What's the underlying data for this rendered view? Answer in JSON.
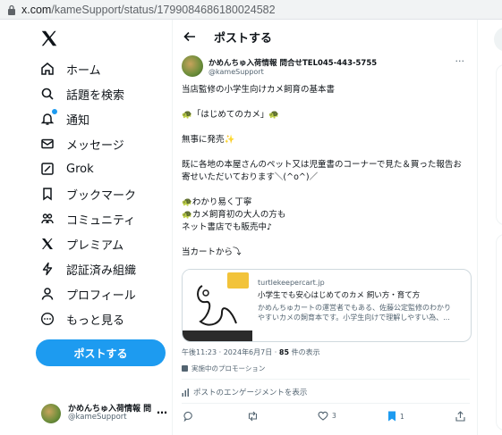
{
  "browser": {
    "url_host": "x.com",
    "url_path": "/kameSupport/status/1799084686180024582"
  },
  "nav": {
    "items": [
      {
        "label": "ホーム",
        "icon": "home-icon"
      },
      {
        "label": "話題を検索",
        "icon": "search-icon"
      },
      {
        "label": "通知",
        "icon": "bell-icon"
      },
      {
        "label": "メッセージ",
        "icon": "mail-icon"
      },
      {
        "label": "Grok",
        "icon": "grok-icon"
      },
      {
        "label": "ブックマーク",
        "icon": "bookmark-icon"
      },
      {
        "label": "コミュニティ",
        "icon": "communities-icon"
      },
      {
        "label": "プレミアム",
        "icon": "x-premium-icon"
      },
      {
        "label": "認証済み組織",
        "icon": "lightning-icon"
      },
      {
        "label": "プロフィール",
        "icon": "person-icon"
      },
      {
        "label": "もっと見る",
        "icon": "more-circle-icon"
      }
    ],
    "post_button": "ポストする"
  },
  "account": {
    "name": "かめんちゅ入荷情報 問",
    "handle": "@kameSupport"
  },
  "header": {
    "title": "ポストする"
  },
  "tweet": {
    "author_name": "かめんちゅ入荷情報 問合せTEL045-443-5755",
    "author_handle": "@kameSupport",
    "lines": [
      "当店監修の小学生向けカメ飼育の基本書",
      "🐢「はじめてのカメ」🐢",
      "無事に発売✨",
      "既に各地の本屋さんのペット又は児童書のコーナーで見た＆買った報告お",
      "寄せいただいております＼(^o^)／",
      "🐢わかり易く丁寧",
      "🐢カメ飼育初の大人の方も",
      "ネット書店でも販売中♪",
      "当カートから⤵"
    ],
    "card": {
      "domain": "turtlekeepercart.jp",
      "title": "小学生でも安心はじめてのカメ 飼い方・育て方",
      "desc_line1": "かめんちゅカートの運営者でもある、佐藤公定監修のわかり",
      "desc_line2": "やすいカメの飼育本です。小学生向けで理解しやすい為、..."
    },
    "time": "午後11:23",
    "date": "2024年6月7日",
    "views_count": "85",
    "views_label": "件の表示",
    "promo": "実施中のプロモーション",
    "engagement": "ポストのエンゲージメントを表示",
    "actions": {
      "reply": "",
      "repost": "",
      "like": "3",
      "bookmark": "1",
      "share": ""
    }
  },
  "colors": {
    "accent": "#1d9bf0",
    "text": "#0f1419",
    "secondary": "#536471"
  }
}
